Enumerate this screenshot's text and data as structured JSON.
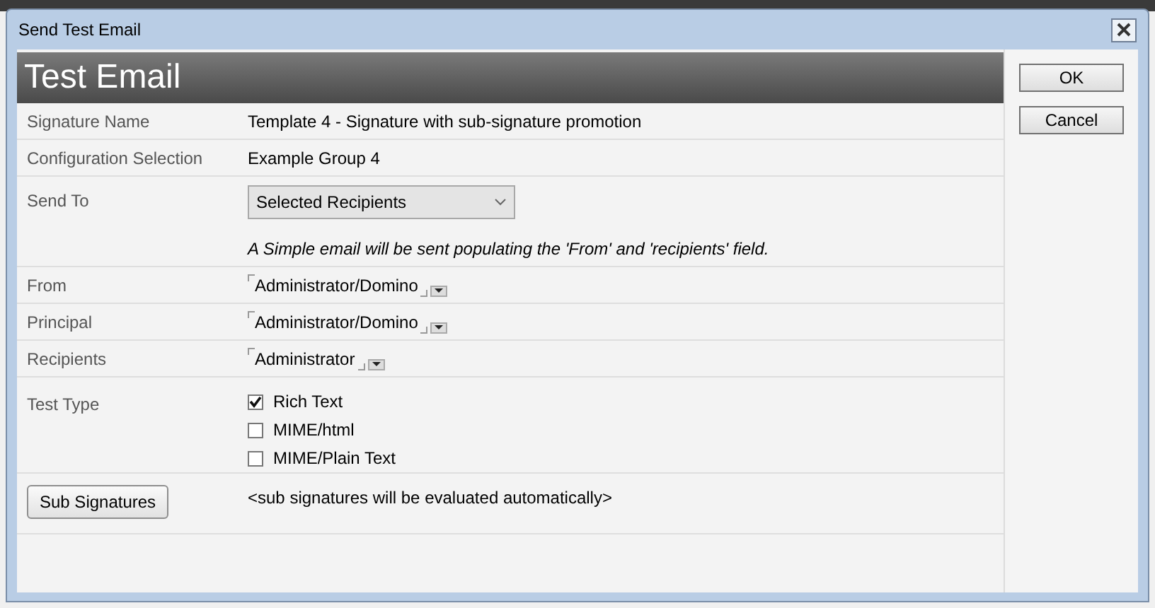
{
  "window": {
    "title": "Send Test Email"
  },
  "header": "Test Email",
  "fields": [
    {
      "kind": "text",
      "label": "Signature Name",
      "value": "Template 4 - Signature with sub-signature promotion"
    },
    {
      "kind": "text",
      "label": "Configuration Selection",
      "value": "Example Group 4"
    },
    {
      "kind": "select",
      "label": "Send To",
      "value": "Selected Recipients",
      "note": "A Simple email will be sent populating the 'From' and 'recipients' field."
    },
    {
      "kind": "names",
      "label": "From",
      "value": "Administrator/Domino"
    },
    {
      "kind": "names",
      "label": "Principal",
      "value": "Administrator/Domino"
    },
    {
      "kind": "names",
      "label": "Recipients",
      "value": "Administrator"
    },
    {
      "kind": "checks",
      "label": "Test Type",
      "options": [
        {
          "label": "Rich Text",
          "checked": true
        },
        {
          "label": "MIME/html",
          "checked": false
        },
        {
          "label": "MIME/Plain Text",
          "checked": false
        }
      ]
    },
    {
      "kind": "button",
      "button": "Sub Signatures",
      "value": "<sub signatures will be evaluated automatically>"
    }
  ],
  "buttons": [
    "OK",
    "Cancel"
  ]
}
